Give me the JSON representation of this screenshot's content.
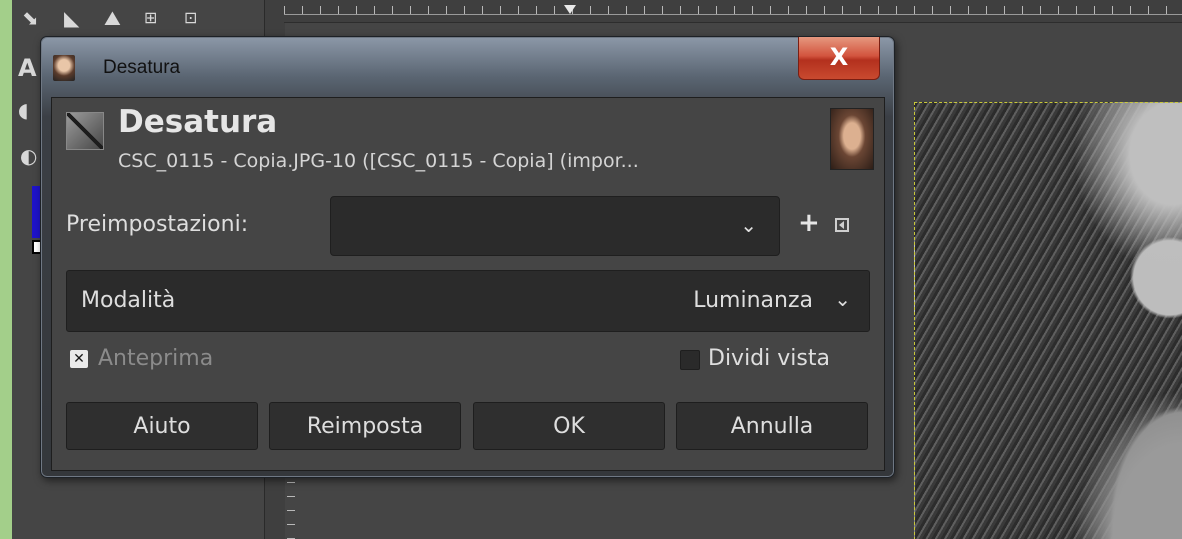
{
  "window": {
    "title": "Desatura",
    "close_glyph": "X"
  },
  "header": {
    "title": "Desatura",
    "subtitle": "CSC_0115 - Copia.JPG-10 ([CSC_0115 - Copia] (impor..."
  },
  "presets": {
    "label": "Preimpostazioni:",
    "value": "",
    "add_glyph": "+",
    "chevron": "⌄"
  },
  "mode": {
    "label": "Modalità",
    "value": "Luminanza",
    "chevron": "⌄"
  },
  "options": {
    "preview": {
      "label": "Anteprima",
      "checked": true,
      "check_glyph": "✕"
    },
    "split_view": {
      "label": "Dividi vista",
      "checked": false
    }
  },
  "buttons": {
    "help": "Aiuto",
    "reset": "Reimposta",
    "ok": "OK",
    "cancel": "Annulla"
  },
  "toolbox": {
    "text_tool_glyph": "A"
  },
  "colors": {
    "foreground": "#1e13c9",
    "accent_close": "#c94a2f",
    "dialog_bg": "#454545",
    "page_bg": "#a3cf8a"
  }
}
